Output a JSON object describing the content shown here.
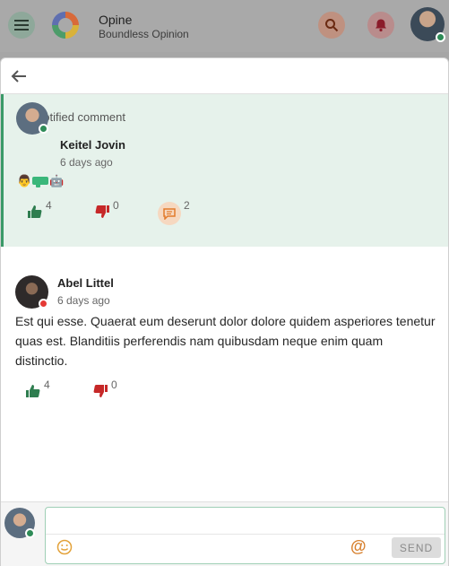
{
  "app": {
    "name": "Opine",
    "subtitle": "Boundless Opinion",
    "icons": [
      "menu-icon",
      "logo-icon",
      "search-icon",
      "bell-icon"
    ],
    "colors": {
      "accent": "#3a9a68",
      "online": "#2e8b57",
      "offline": "#e53935",
      "like": "#2e7d4f",
      "dislike": "#c62828",
      "comment": "#e27a2b"
    }
  },
  "notification": {
    "label": "notified comment",
    "comment": {
      "author": "Keitel Jovin",
      "time": "6 days ago",
      "emojis": [
        "👨",
        "🔫",
        "🤖"
      ],
      "likes": "4",
      "dislikes": "0",
      "replies": "2"
    }
  },
  "reply": {
    "author": "Abel Littel",
    "time": "6 days ago",
    "text": "Est qui esse. Quaerat eum deserunt dolor dolore quidem asperiores tenetur quas est. Blanditiis perferendis nam quibusdam neque enim quam distinctio.",
    "likes": "4",
    "dislikes": "0"
  },
  "composer": {
    "value": "",
    "placeholder": "",
    "send_label": "SEND"
  }
}
